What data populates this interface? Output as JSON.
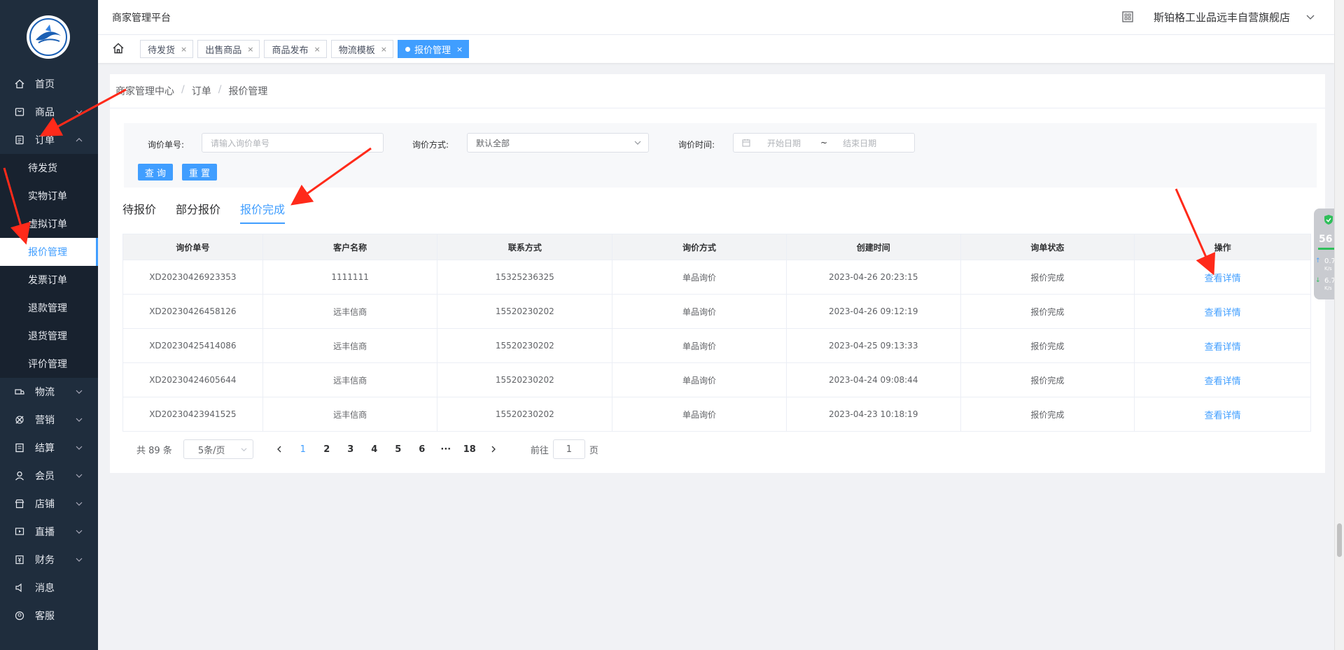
{
  "header": {
    "platform_title": "商家管理平台",
    "store_name": "斯铂格工业品远丰自营旗舰店"
  },
  "sidebar": {
    "items": [
      {
        "label": "首页",
        "icon": "home-icon"
      },
      {
        "label": "商品",
        "icon": "goods-icon",
        "expandable": true
      },
      {
        "label": "订单",
        "icon": "order-icon",
        "expandable": true,
        "expanded": true
      },
      {
        "label": "物流",
        "icon": "logistics-icon",
        "expandable": true
      },
      {
        "label": "营销",
        "icon": "marketing-icon",
        "expandable": true
      },
      {
        "label": "结算",
        "icon": "settlement-icon",
        "expandable": true
      },
      {
        "label": "会员",
        "icon": "member-icon",
        "expandable": true
      },
      {
        "label": "店铺",
        "icon": "shop-icon",
        "expandable": true
      },
      {
        "label": "直播",
        "icon": "live-icon",
        "expandable": true
      },
      {
        "label": "财务",
        "icon": "finance-icon",
        "expandable": true
      },
      {
        "label": "消息",
        "icon": "message-icon"
      },
      {
        "label": "客服",
        "icon": "service-icon"
      }
    ],
    "order_submenu": [
      "待发货",
      "实物订单",
      "虚拟订单",
      "报价管理",
      "发票订单",
      "退款管理",
      "退货管理",
      "评价管理"
    ],
    "active_submenu": "报价管理"
  },
  "tags": [
    {
      "label": "待发货"
    },
    {
      "label": "出售商品"
    },
    {
      "label": "商品发布"
    },
    {
      "label": "物流模板"
    },
    {
      "label": "报价管理",
      "active": true
    }
  ],
  "breadcrumb": [
    "商家管理中心",
    "订单",
    "报价管理"
  ],
  "filter": {
    "inquiry_no_label": "询价单号:",
    "inquiry_no_placeholder": "请输入询价单号",
    "method_label": "询价方式:",
    "method_value": "默认全部",
    "time_label": "询价时间:",
    "start_placeholder": "开始日期",
    "range_sep": "~",
    "end_placeholder": "结束日期",
    "search_btn": "查 询",
    "reset_btn": "重 置"
  },
  "status_tabs": [
    "待报价",
    "部分报价",
    "报价完成"
  ],
  "active_status_tab": "报价完成",
  "table": {
    "columns": [
      "询价单号",
      "客户名称",
      "联系方式",
      "询价方式",
      "创建时间",
      "询单状态",
      "操作"
    ],
    "rows": [
      [
        "XD20230426923353",
        "1111111",
        "15325236325",
        "单品询价",
        "2023-04-26 20:23:15",
        "报价完成",
        "查看详情"
      ],
      [
        "XD20230426458126",
        "远丰信商",
        "15520230202",
        "单品询价",
        "2023-04-26 09:12:19",
        "报价完成",
        "查看详情"
      ],
      [
        "XD20230425414086",
        "远丰信商",
        "15520230202",
        "单品询价",
        "2023-04-25 09:13:33",
        "报价完成",
        "查看详情"
      ],
      [
        "XD20230424605644",
        "远丰信商",
        "15520230202",
        "单品询价",
        "2023-04-24 09:08:44",
        "报价完成",
        "查看详情"
      ],
      [
        "XD20230423941525",
        "远丰信商",
        "15520230202",
        "单品询价",
        "2023-04-23 10:18:19",
        "报价完成",
        "查看详情"
      ]
    ]
  },
  "pagination": {
    "total": "共 89 条",
    "page_size": "5条/页",
    "pages": [
      "1",
      "2",
      "3",
      "4",
      "5",
      "6",
      "···",
      "18"
    ],
    "current": "1",
    "goto_prefix": "前往",
    "goto_value": "1",
    "goto_suffix": "页"
  },
  "widget": {
    "percent": "56",
    "up_speed": "0.7",
    "down_speed": "6.7",
    "unit": "K/s"
  },
  "colors": {
    "primary": "#409eff",
    "sidebar": "#1f2d3d",
    "annotation": "#ff2a1a"
  }
}
